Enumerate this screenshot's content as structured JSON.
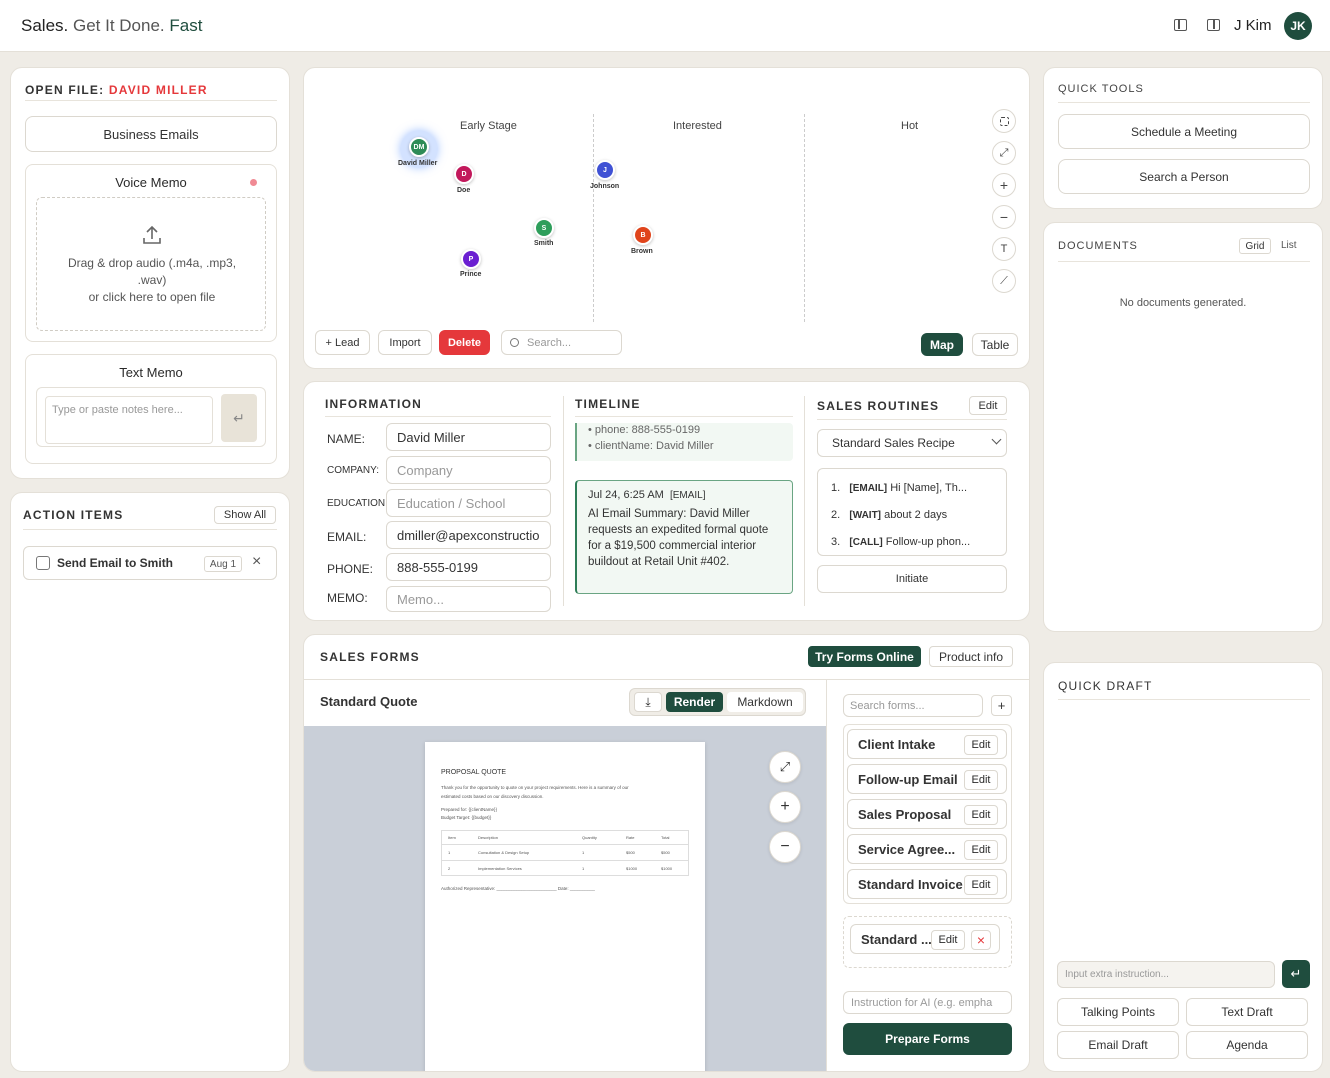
{
  "header": {
    "brand_a": "Sales.",
    "brand_b": " Get It Done. ",
    "brand_c": "Fast",
    "user_name": "J Kim",
    "avatar": "JK"
  },
  "colors": {
    "accent": "#1f4d3e",
    "danger": "#e5383b",
    "bg": "#efece6"
  },
  "open_file": {
    "label": "OPEN FILE:",
    "name": "DAVID MILLER",
    "business_emails": "Business Emails",
    "voice_memo_title": "Voice Memo",
    "drop_line1": "Drag & drop audio (.m4a, .mp3,",
    "drop_line2": ".wav)",
    "drop_line3": "or click here to open file",
    "text_memo_title": "Text Memo",
    "text_memo_placeholder": "Type or paste notes here..."
  },
  "action_items": {
    "title": "ACTION ITEMS",
    "show_all": "Show All",
    "items": [
      {
        "label": "Send Email to Smith",
        "date": "Aug 1"
      }
    ]
  },
  "map": {
    "stages": [
      "Early Stage",
      "Interested",
      "Hot"
    ],
    "nodes": [
      {
        "initials": "DM",
        "name": "David Miller",
        "color": "#2e8b57"
      },
      {
        "initials": "D",
        "name": "Doe",
        "color": "#c2185b"
      },
      {
        "initials": "J",
        "name": "Johnson",
        "color": "#3f51d4"
      },
      {
        "initials": "S",
        "name": "Smith",
        "color": "#2e9e5b"
      },
      {
        "initials": "B",
        "name": "Brown",
        "color": "#e0441b"
      },
      {
        "initials": "P",
        "name": "Prince",
        "color": "#6a1fd1"
      }
    ],
    "add_lead": "+ Lead",
    "import": "Import",
    "delete": "Delete",
    "search_placeholder": "Search...",
    "view_map": "Map",
    "view_table": "Table",
    "text_tool": "T"
  },
  "information": {
    "title": "INFORMATION",
    "fields": [
      {
        "label": "NAME:",
        "value": "David Miller",
        "placeholder": ""
      },
      {
        "label": "COMPANY:",
        "value": "",
        "placeholder": "Company"
      },
      {
        "label": "EDUCATION:",
        "value": "",
        "placeholder": "Education / School"
      },
      {
        "label": "EMAIL:",
        "value": "dmiller@apexconstructio",
        "placeholder": ""
      },
      {
        "label": "PHONE:",
        "value": "888-555-0199",
        "placeholder": ""
      },
      {
        "label": "MEMO:",
        "value": "",
        "placeholder": "Memo..."
      }
    ]
  },
  "timeline": {
    "title": "TIMELINE",
    "bullet1": "• phone: 888-555-0199",
    "bullet2": "• clientName: David Miller",
    "entry_date": "Jul 24, 6:25 AM",
    "entry_tag": "[EMAIL]",
    "entry_text": "AI Email Summary: David Miller requests an expedited formal quote for a $19,500 commercial interior buildout at Retail Unit #402."
  },
  "routines": {
    "title": "SALES ROUTINES",
    "edit": "Edit",
    "selected": "Standard Sales Recipe",
    "steps": [
      {
        "n": "1.",
        "tag": "[EMAIL]",
        "text": "Hi [Name], Th..."
      },
      {
        "n": "2.",
        "tag": "[WAIT]",
        "text": "about 2 days"
      },
      {
        "n": "3.",
        "tag": "[CALL]",
        "text": "Follow-up phon..."
      }
    ],
    "initiate": "Initiate"
  },
  "sales_forms": {
    "title": "SALES FORMS",
    "try_online": "Try Forms Online",
    "product_info": "Product info",
    "doc_title": "Standard Quote",
    "render": "Render",
    "markdown": "Markdown",
    "search_placeholder": "Search forms...",
    "add": "+",
    "forms": [
      {
        "name": "Client Intake",
        "edit": "Edit"
      },
      {
        "name": "Follow-up Email",
        "edit": "Edit"
      },
      {
        "name": "Sales Proposal",
        "edit": "Edit"
      },
      {
        "name": "Service Agree...",
        "edit": "Edit"
      },
      {
        "name": "Standard Invoice",
        "edit": "Edit"
      }
    ],
    "selected_form": {
      "name": "Standard ...",
      "edit": "Edit"
    },
    "instruction_placeholder": "Instruction for AI (e.g. empha",
    "prepare": "Prepare Forms",
    "doc": {
      "heading": "PROPOSAL QUOTE",
      "intro1": "Thank you for the opportunity to quote on your project requirements. Here is a summary of our",
      "intro2": "estimated costs based on our discovery discussion.",
      "prepared": "Prepared for: {{clientName}}",
      "budget": "Budget Target: {{budget}}",
      "cols": [
        "Item",
        "Description",
        "Quantity",
        "Rate",
        "Total"
      ],
      "rows": [
        [
          "1",
          "Consultation & Design Setup",
          "1",
          "$500",
          "$500"
        ],
        [
          "2",
          "Implementation Services",
          "1",
          "$1000",
          "$1000"
        ]
      ],
      "sign": "Authorized Representative: ________________________   Date: __________"
    }
  },
  "quick_tools": {
    "title": "QUICK TOOLS",
    "schedule": "Schedule a Meeting",
    "search": "Search a Person"
  },
  "documents": {
    "title": "DOCUMENTS",
    "grid": "Grid",
    "list": "List",
    "empty": "No documents generated."
  },
  "quick_draft": {
    "title": "QUICK DRAFT",
    "input_placeholder": "Input extra instruction...",
    "buttons": [
      "Talking Points",
      "Text Draft",
      "Email Draft",
      "Agenda"
    ]
  }
}
